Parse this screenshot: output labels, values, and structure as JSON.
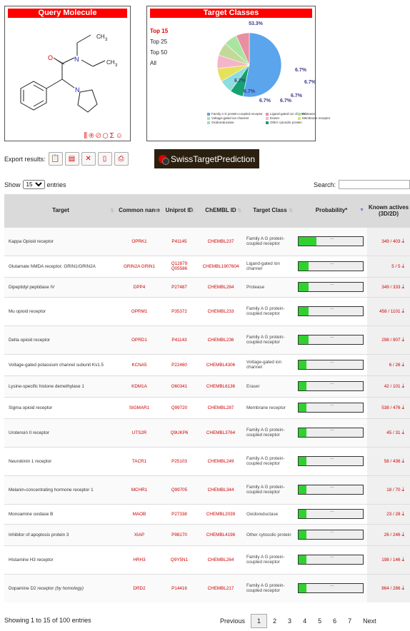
{
  "query_panel": {
    "title": "Query Molecule",
    "atoms": {
      "ch3_top": "CH",
      "ch3_top_sub": "3",
      "n1": "N",
      "o": "O",
      "ch3_right": "CH",
      "ch3_right_sub": "3",
      "n2": "N"
    }
  },
  "target_panel": {
    "title": "Target Classes",
    "links": [
      "Top 15",
      "Top 25",
      "Top 50",
      "All"
    ],
    "legend": [
      {
        "label": "Family A G protein-coupled receptor",
        "color": "#5aa5ec"
      },
      {
        "label": "Ligand-gated ion channel",
        "color": "#e88fa3"
      },
      {
        "label": "Protease",
        "color": "#a8e6a0"
      },
      {
        "label": "Voltage-gated ion channel",
        "color": "#c4d89a"
      },
      {
        "label": "Eraser",
        "color": "#f4b5c8"
      },
      {
        "label": "Membrane receptor",
        "color": "#e6e15a"
      },
      {
        "label": "Oxidoreductase",
        "color": "#8ddde0"
      },
      {
        "label": "Other cytosolic protein",
        "color": "#17a070"
      }
    ]
  },
  "chart_data": {
    "type": "pie",
    "title": "",
    "slices": [
      {
        "label": "Family A G protein-coupled receptor",
        "value": 53.3
      },
      {
        "label": "Other cytosolic protein",
        "value": 6.7
      },
      {
        "label": "Oxidoreductase",
        "value": 6.7
      },
      {
        "label": "Membrane receptor",
        "value": 6.7
      },
      {
        "label": "Eraser",
        "value": 6.7
      },
      {
        "label": "Voltage-gated ion channel",
        "value": 6.7
      },
      {
        "label": "Protease",
        "value": 6.7
      },
      {
        "label": "Ligand-gated ion channel",
        "value": 6.7
      }
    ],
    "data_labels": [
      "53.3%",
      "6.7%",
      "6.7%",
      "6.7%",
      "6.7%",
      "6.7%",
      "6.7%",
      "6.7%"
    ]
  },
  "export": {
    "label": "Export results:"
  },
  "stp_button": {
    "label": "SwissTargetPrediction"
  },
  "show": {
    "prefix": "Show",
    "value": "15",
    "suffix": "entries"
  },
  "search": {
    "label": "Search:"
  },
  "table": {
    "headers": [
      "Target",
      "Common name",
      "Uniprot ID",
      "ChEMBL ID",
      "Target Class",
      "Probability*",
      "Known actives (3D/2D)"
    ],
    "rows": [
      {
        "target": "Kappa Opioid receptor",
        "common": "OPRK1",
        "uniprot": "P41145",
        "chembl": "CHEMBL237",
        "cls": "Family A G protein-coupled receptor",
        "prob": 0.28,
        "actives": "349 / 403"
      },
      {
        "target": "Glutamate NMDA receptor; GRIN1/GRIN2A",
        "common": "GRIN2A GRIN1",
        "uniprot": "Q12879 Q05586",
        "chembl": "CHEMBL1907604",
        "cls": "Ligand-gated ion channel",
        "prob": 0.15,
        "actives": "5 / 5"
      },
      {
        "target": "Dipeptidyl peptidase IV",
        "common": "DPP4",
        "uniprot": "P27487",
        "chembl": "CHEMBL284",
        "cls": "Protease",
        "prob": 0.15,
        "actives": "349 / 333"
      },
      {
        "target": "Mu opioid receptor",
        "common": "OPRM1",
        "uniprot": "P35372",
        "chembl": "CHEMBL233",
        "cls": "Family A G protein-coupled receptor",
        "prob": 0.15,
        "actives": "458 / 1101"
      },
      {
        "target": "Delta opioid receptor",
        "common": "OPRD1",
        "uniprot": "P41143",
        "chembl": "CHEMBL236",
        "cls": "Family A G protein-coupled receptor",
        "prob": 0.15,
        "actives": "298 / 907"
      },
      {
        "target": "Voltage-gated potassium channel subunit Kv1.5",
        "common": "KCNA5",
        "uniprot": "P22460",
        "chembl": "CHEMBL4306",
        "cls": "Voltage-gated ion channel",
        "prob": 0.12,
        "actives": "6 / 26"
      },
      {
        "target": "Lysine-specific histone demethylase 1",
        "common": "KDM1A",
        "uniprot": "O60341",
        "chembl": "CHEMBL6136",
        "cls": "Eraser",
        "prob": 0.12,
        "actives": "42 / 101"
      },
      {
        "target": "Sigma opioid receptor",
        "common": "SIGMAR1",
        "uniprot": "Q99720",
        "chembl": "CHEMBL287",
        "cls": "Membrane receptor",
        "prob": 0.12,
        "actives": "538 / 476"
      },
      {
        "target": "Urotensin II receptor",
        "common": "UTS2R",
        "uniprot": "Q9UKP6",
        "chembl": "CHEMBL3764",
        "cls": "Family A G protein-coupled receptor",
        "prob": 0.12,
        "actives": "45 / 31"
      },
      {
        "target": "Neurokinin 1 receptor",
        "common": "TACR1",
        "uniprot": "P25103",
        "chembl": "CHEMBL249",
        "cls": "Family A G protein-coupled receptor",
        "prob": 0.12,
        "actives": "58 / 436"
      },
      {
        "target": "Melanin-concentrating hormone receptor 1",
        "common": "MCHR1",
        "uniprot": "Q99705",
        "chembl": "CHEMBL344",
        "cls": "Family A G protein-coupled receptor",
        "prob": 0.12,
        "actives": "18 / 70"
      },
      {
        "target": "Monoamine oxidase B",
        "common": "MAOB",
        "uniprot": "P27338",
        "chembl": "CHEMBL2039",
        "cls": "Oxidoreductase",
        "prob": 0.12,
        "actives": "23 / 28"
      },
      {
        "target": "Inhibitor of apoptosis protein 3",
        "common": "XIAP",
        "uniprot": "P98170",
        "chembl": "CHEMBL4198",
        "cls": "Other cytosolic protein",
        "prob": 0.12,
        "actives": "26 / 246"
      },
      {
        "target": "Histamine H3 receptor",
        "common": "HRH3",
        "uniprot": "Q9Y5N1",
        "chembl": "CHEMBL264",
        "cls": "Family A G protein-coupled receptor",
        "prob": 0.12,
        "actives": "198 / 146"
      },
      {
        "target": "Dopamine D2 receptor",
        "target_note": "(by homology)",
        "common": "DRD2",
        "uniprot": "P14416",
        "chembl": "CHEMBL217",
        "cls": "Family A G protein-coupled receptor",
        "prob": 0.12,
        "actives": "864 / 286"
      }
    ]
  },
  "footer": {
    "info": "Showing 1 to 15 of 100 entries"
  },
  "pager": {
    "prev": "Previous",
    "pages": [
      "1",
      "2",
      "3",
      "4",
      "5",
      "6",
      "7"
    ],
    "next": "Next"
  }
}
